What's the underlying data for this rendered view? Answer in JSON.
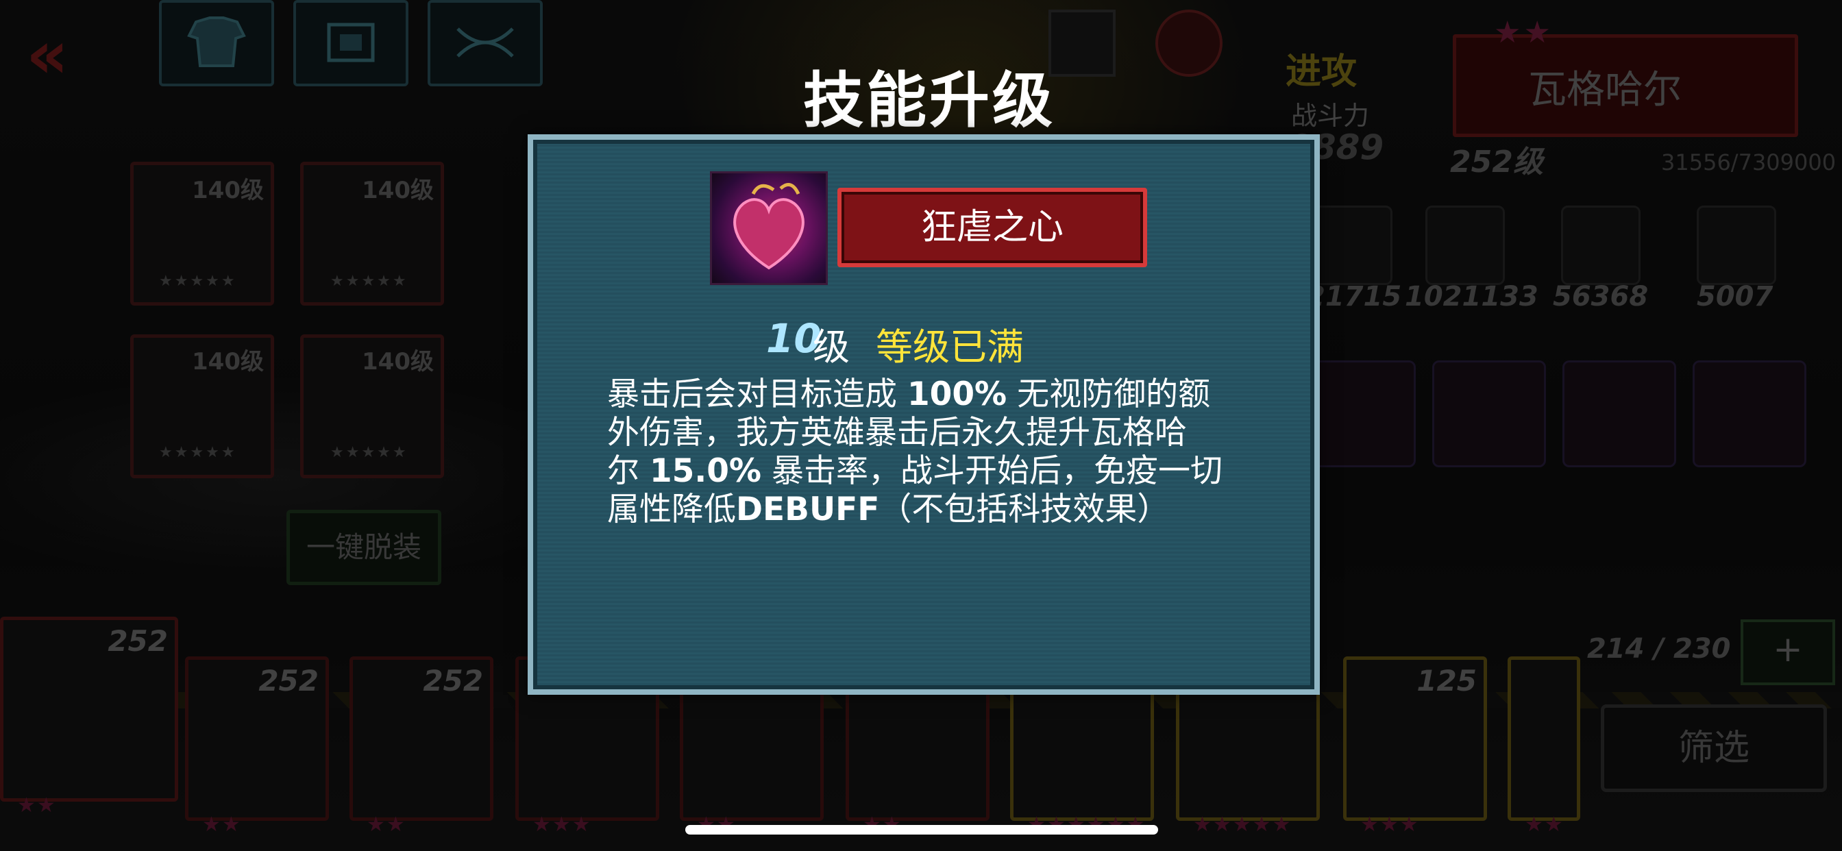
{
  "modal": {
    "title": "技能升级",
    "skill_name": "狂虐之心",
    "level_num": "10",
    "level_unit": "级",
    "level_status": "等级已满",
    "description": {
      "line1_a": "暴击后会对目标造成 ",
      "line1_pct": "100%",
      "line1_b": " 无视防御的额",
      "line2": "外伤害，我方英雄暴击后永久提升瓦格哈",
      "line3_a": "尔 ",
      "line3_pct": "15.0%",
      "line3_b": " 暴击率，战斗开始后，免疫一切",
      "line4_a": "属性降低",
      "line4_debuff": "DEBUFF",
      "line4_b": "（不包括科技效果）"
    }
  },
  "hero": {
    "attack_label": "进攻",
    "power_label": "战斗力",
    "power_value": "0889",
    "name": "瓦格哈尔",
    "stars": "★★",
    "level": "252级",
    "exp": "31556/7309000"
  },
  "stats": [
    "21715",
    "1021133",
    "56368",
    "5007"
  ],
  "gear": [
    {
      "level": "140级",
      "stars": "★★★★★"
    },
    {
      "level": "140级",
      "stars": "★★★★★"
    },
    {
      "level": "140级",
      "stars": "★★★★★"
    },
    {
      "level": "140级",
      "stars": "★★★★★"
    }
  ],
  "unequip_label": "一键脱装",
  "roster": {
    "count": "214 / 230",
    "add_label": "+",
    "filter_label": "筛选",
    "cards": [
      {
        "level": "252",
        "stars": "★★"
      },
      {
        "level": "252",
        "stars": "★★"
      },
      {
        "level": "252",
        "stars": "★★"
      },
      {
        "level": "",
        "stars": "★★★"
      },
      {
        "level": "",
        "stars": "★★"
      },
      {
        "level": "",
        "stars": "★★"
      },
      {
        "level": "",
        "stars": "★★★★★★"
      },
      {
        "level": "",
        "stars": "★★★★★"
      },
      {
        "level": "125",
        "stars": "★★★"
      },
      {
        "level": "",
        "stars": "★★"
      }
    ]
  },
  "icons": {
    "back": "double-chevron-left-icon",
    "armor": "armor-icon",
    "chip": "chip-icon",
    "dna": "dna-icon",
    "lock": "lock-icon"
  }
}
